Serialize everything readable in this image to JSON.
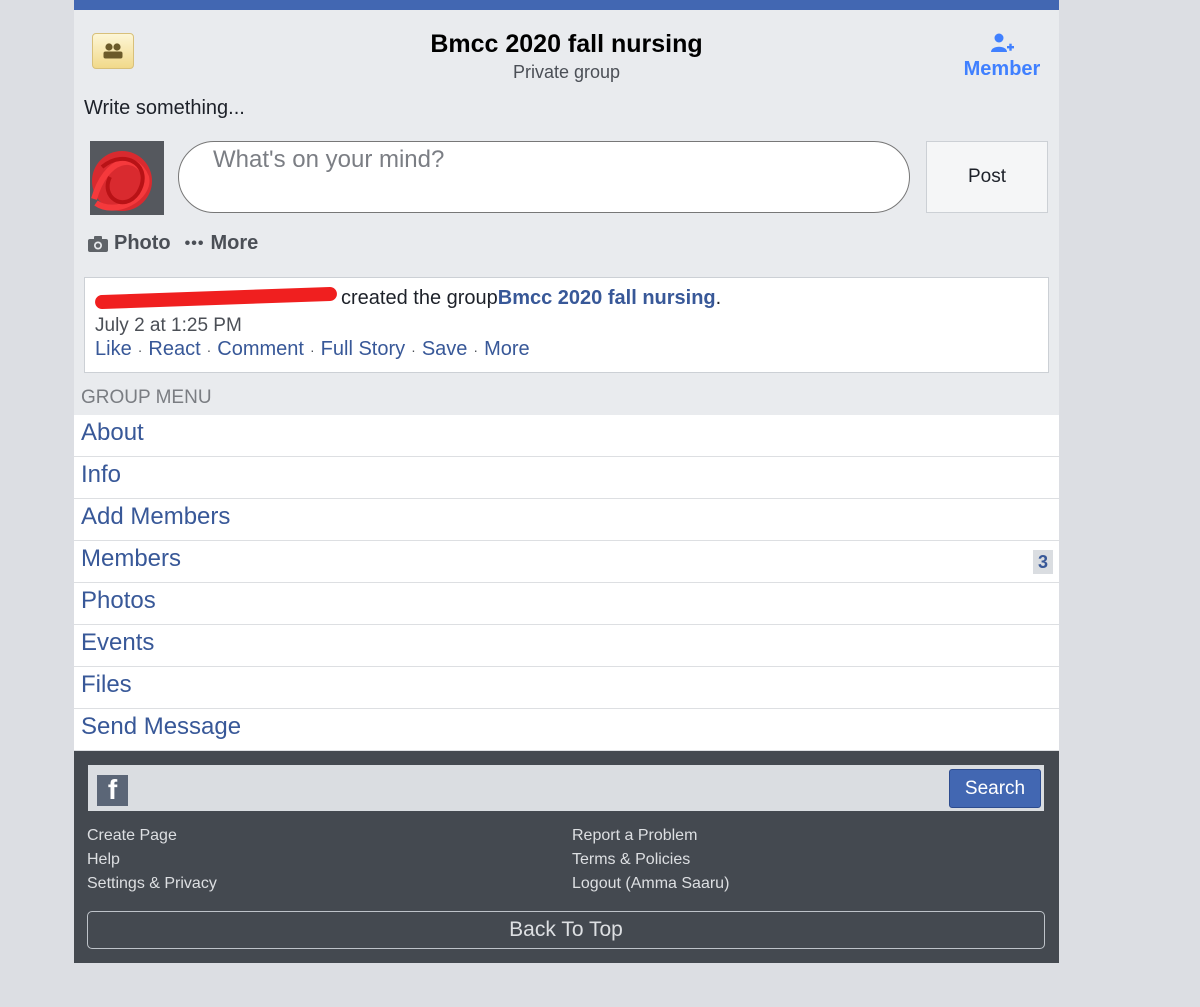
{
  "group": {
    "name": "Bmcc 2020 fall nursing",
    "privacy": "Private group",
    "member_label": "Member"
  },
  "composer": {
    "write_label": "Write something...",
    "placeholder": "What's on your mind?",
    "post_label": "Post",
    "actions": [
      "Photo",
      "More"
    ]
  },
  "story": {
    "text_before": "created the group ",
    "group_link": "Bmcc 2020 fall nursing",
    "text_after": ".",
    "timestamp": "July 2 at 1:25 PM",
    "links": [
      "Like",
      "React",
      "Comment",
      "Full Story",
      "Save",
      "More"
    ]
  },
  "menu": {
    "header": "GROUP MENU",
    "items": [
      {
        "label": "About"
      },
      {
        "label": "Info"
      },
      {
        "label": "Add Members"
      },
      {
        "label": "Members",
        "badge": "3"
      },
      {
        "label": "Photos"
      },
      {
        "label": "Events"
      },
      {
        "label": "Files"
      },
      {
        "label": "Send Message"
      }
    ]
  },
  "footer": {
    "search_label": "Search",
    "left_links": [
      "Create Page",
      "Help",
      "Settings & Privacy"
    ],
    "right_links": [
      "Report a Problem",
      "Terms & Policies",
      "Logout (Amma Saaru)"
    ],
    "back_to_top": "Back To Top"
  },
  "icons": {
    "group": "group-people-icon",
    "member": "person-add-icon",
    "photo": "camera-icon",
    "more": "ellipsis-icon",
    "facebook": "facebook-logo-icon"
  },
  "colors": {
    "brand": "#4267b2",
    "link": "#385898",
    "member_accent": "#4080ff",
    "redaction": "#f01f1f"
  }
}
